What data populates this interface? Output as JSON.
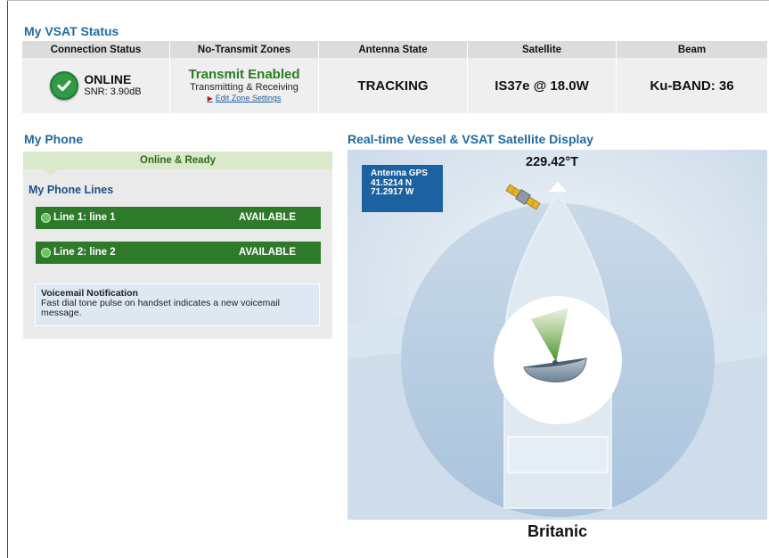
{
  "vsat": {
    "title": "My VSAT Status",
    "headers": {
      "connection": "Connection Status",
      "zones": "No-Transmit Zones",
      "antenna": "Antenna State",
      "satellite": "Satellite",
      "beam": "Beam"
    },
    "connection": {
      "state": "ONLINE",
      "snr": "SNR: 3.90dB"
    },
    "zones": {
      "title": "Transmit Enabled",
      "subtitle": "Transmitting & Receiving",
      "link": "Edit Zone Settings"
    },
    "antenna_state": "TRACKING",
    "satellite": "IS37e @ 18.0W",
    "beam": "Ku-BAND: 36",
    "colors": {
      "accent": "#1f6aa5",
      "ok": "#2f9b45",
      "enabled": "#2a7b23"
    }
  },
  "phone": {
    "title": "My Phone",
    "ready": "Online & Ready",
    "lines_title": "My Phone Lines",
    "lines": [
      {
        "name": "Line 1: line 1",
        "status": "AVAILABLE"
      },
      {
        "name": "Line 2: line 2",
        "status": "AVAILABLE"
      }
    ],
    "voicemail": {
      "title": "Voicemail Notification",
      "text": "Fast dial tone pulse on handset indicates a new voicemail message."
    }
  },
  "display": {
    "title": "Real-time Vessel & VSAT Satellite Display",
    "heading": "229.42°T",
    "gps": {
      "label": "Antenna GPS",
      "lat": "41.5214 N",
      "lon": "71.2917 W"
    },
    "vessel_name": "Britanic",
    "icons": [
      "satellite-icon",
      "ship-icon",
      "antenna-dish-icon",
      "check-icon",
      "triangle-right-icon"
    ]
  }
}
